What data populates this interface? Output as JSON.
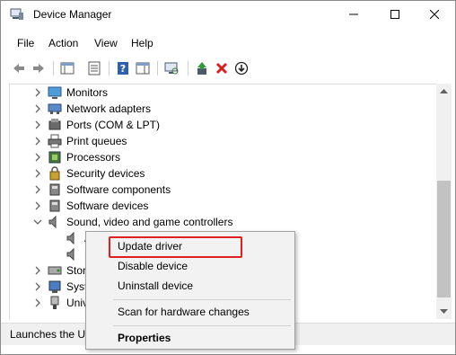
{
  "window": {
    "title": "Device Manager",
    "icons": {
      "app": "device-manager-icon",
      "minimize": "minimize-icon",
      "maximize": "maximize-icon",
      "close": "close-icon"
    }
  },
  "menu": {
    "file": "File",
    "action": "Action",
    "view": "View",
    "help": "Help"
  },
  "toolbar": [
    "back-arrow-icon",
    "forward-arrow-icon",
    "show-hide-console-tree-icon",
    "properties-icon",
    "help-icon",
    "action-pane-icon",
    "scan-hardware-icon",
    "update-driver-icon",
    "uninstall-device-icon",
    "disable-device-icon"
  ],
  "tree": {
    "rows": [
      {
        "label": "Monitors",
        "icon": "monitor-icon"
      },
      {
        "label": "Network adapters",
        "icon": "network-adapter-icon"
      },
      {
        "label": "Ports (COM & LPT)",
        "icon": "port-icon"
      },
      {
        "label": "Print queues",
        "icon": "printer-icon"
      },
      {
        "label": "Processors",
        "icon": "processor-icon"
      },
      {
        "label": "Security devices",
        "icon": "security-device-icon"
      },
      {
        "label": "Software components",
        "icon": "software-component-icon"
      },
      {
        "label": "Software devices",
        "icon": "software-device-icon"
      },
      {
        "label": "Sound, video and game controllers",
        "icon": "speaker-icon"
      },
      {
        "label": "A",
        "icon": "speaker-icon"
      },
      {
        "label": "R",
        "icon": "speaker-icon"
      },
      {
        "label": "Stor",
        "icon": "storage-controller-icon"
      },
      {
        "label": "Syst",
        "icon": "system-device-icon"
      },
      {
        "label": "Univ",
        "icon": "usb-controller-icon"
      }
    ]
  },
  "context_menu": {
    "update_driver": "Update driver",
    "disable_device": "Disable device",
    "uninstall_device": "Uninstall device",
    "scan_hardware": "Scan for hardware changes",
    "properties": "Properties",
    "highlight_color": "#e02020"
  },
  "status": {
    "text": "Launches the Up"
  }
}
